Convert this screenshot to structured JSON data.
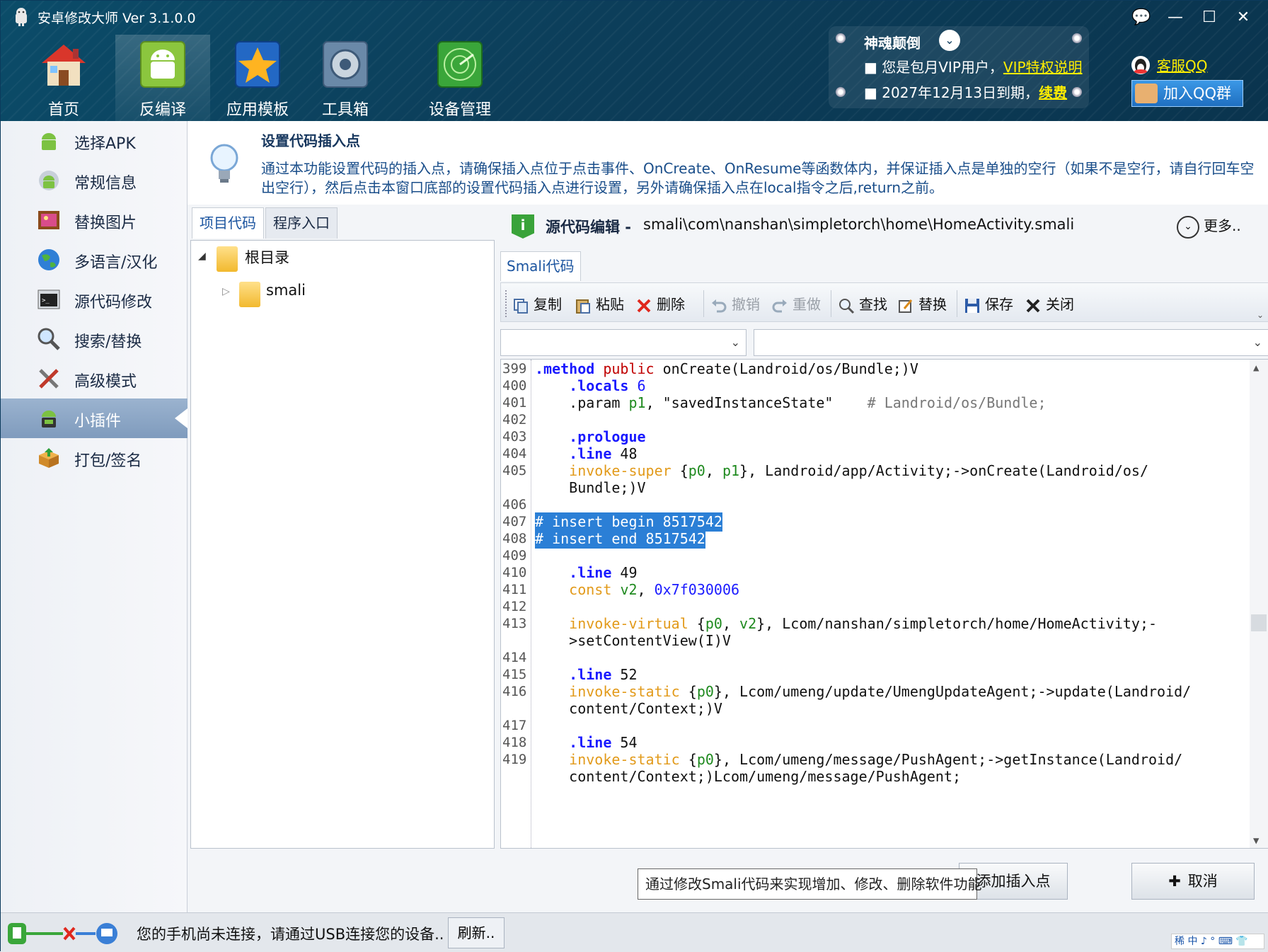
{
  "app": {
    "title": "安卓修改大师 Ver 3.1.0.0"
  },
  "window_controls": {
    "feedback": "💬",
    "minimize": "—",
    "maximize": "☐",
    "close": "✕"
  },
  "nav": [
    {
      "label": "首页",
      "icon": "house-icon"
    },
    {
      "label": "反编译",
      "icon": "android-decompile-icon"
    },
    {
      "label": "应用模板",
      "icon": "star-template-icon"
    },
    {
      "label": "工具箱",
      "icon": "toolbox-icon"
    },
    {
      "label": "设备管理",
      "icon": "radar-device-icon"
    }
  ],
  "vip": {
    "name": "神魂颠倒",
    "line1_prefix": "■ 您是包月VIP用户，",
    "line1_link": "VIP特权说明",
    "line2_prefix": "■ 2027年12月13日到期，",
    "line2_link": "续费"
  },
  "support": {
    "qq": "客服QQ",
    "group": "加入QQ群"
  },
  "sidebar": [
    {
      "label": "选择APK"
    },
    {
      "label": "常规信息"
    },
    {
      "label": "替换图片"
    },
    {
      "label": "多语言/汉化"
    },
    {
      "label": "源代码修改"
    },
    {
      "label": "搜索/替换"
    },
    {
      "label": "高级模式"
    },
    {
      "label": "小插件"
    },
    {
      "label": "打包/签名"
    }
  ],
  "hint": {
    "title": "设置代码插入点",
    "text": "通过本功能设置代码的插入点，请确保插入点位于点击事件、OnCreate、OnResume等函数体内，并保证插入点是单独的空行（如果不是空行，请自行回车空出空行），然后点击本窗口底部的设置代码插入点进行设置，另外请确保插入点在local指令之后,return之前。"
  },
  "left_tabs": {
    "project": "项目代码",
    "entry": "程序入口"
  },
  "tree": {
    "root": "根目录",
    "child": "smali"
  },
  "source": {
    "title": "源代码编辑 -",
    "path": "smali\\com\\nanshan\\simpletorch\\home\\HomeActivity.smali",
    "more": "更多..",
    "tab": "Smali代码"
  },
  "toolbar": {
    "copy": "复制",
    "paste": "粘贴",
    "delete": "删除",
    "undo": "撤销",
    "redo": "重做",
    "find": "查找",
    "replace": "替换",
    "save": "保存",
    "close": "关闭"
  },
  "code": {
    "l399": "399",
    "l400": "400",
    "l401": "401",
    "l402": "402",
    "l403": "403",
    "l404": "404",
    "l405": "405",
    "l406": "406",
    "l407": "407",
    "l408": "408",
    "l409": "409",
    "l410": "410",
    "l411": "411",
    "l412": "412",
    "l413": "413",
    "l414": "414",
    "l415": "415",
    "l416": "416",
    "l417": "417",
    "l418": "418",
    "l419": "419",
    "method": ".method",
    "public": "public",
    "sig": " onCreate(Landroid/os/Bundle;)V",
    "locals": ".locals",
    "locals_n": " 6",
    "param": ".param ",
    "p1": "p1",
    "param_rest": ", \"savedInstanceState\"    ",
    "param_comment": "# Landroid/os/Bundle;",
    "prologue": ".prologue",
    "line": ".line",
    "n48": " 48",
    "n49": " 49",
    "n52": " 52",
    "n54": " 54",
    "invoke_super": "invoke-super",
    "p0": "p0",
    "comma": ", ",
    "l405_a": " {",
    "l405_b": "}, Landroid/app/Activity;->onCreate(Landroid/os/",
    "l405_c": "Bundle;)V",
    "ins_begin": "# insert begin 8517542",
    "ins_end": "# insert end 8517542",
    "const": "const",
    "v2": "v2",
    "hex": "0x7f030006",
    "invoke_virtual": "invoke-virtual",
    "l413_b": "}, Lcom/nanshan/simpletorch/home/HomeActivity;-",
    "l413_c": ">setContentView(I)V",
    "invoke_static": "invoke-static",
    "l416_b": "}, Lcom/umeng/update/UmengUpdateAgent;->update(Landroid/",
    "l416_c": "content/Context;)V",
    "l419_b": "}, Lcom/umeng/message/PushAgent;->getInstance(Landroid/",
    "l419_c": "content/Context;)Lcom/umeng/message/PushAgent;"
  },
  "bottom": {
    "tooltip": "通过修改Smali代码来实现增加、修改、删除软件功能",
    "add": "添加插入点",
    "cancel": "取消"
  },
  "status": {
    "text": "您的手机尚未连接，请通过USB连接您的设备..",
    "refresh": "刷新..",
    "ime": "稀 中 ♪ ° ⌨ 👕"
  }
}
